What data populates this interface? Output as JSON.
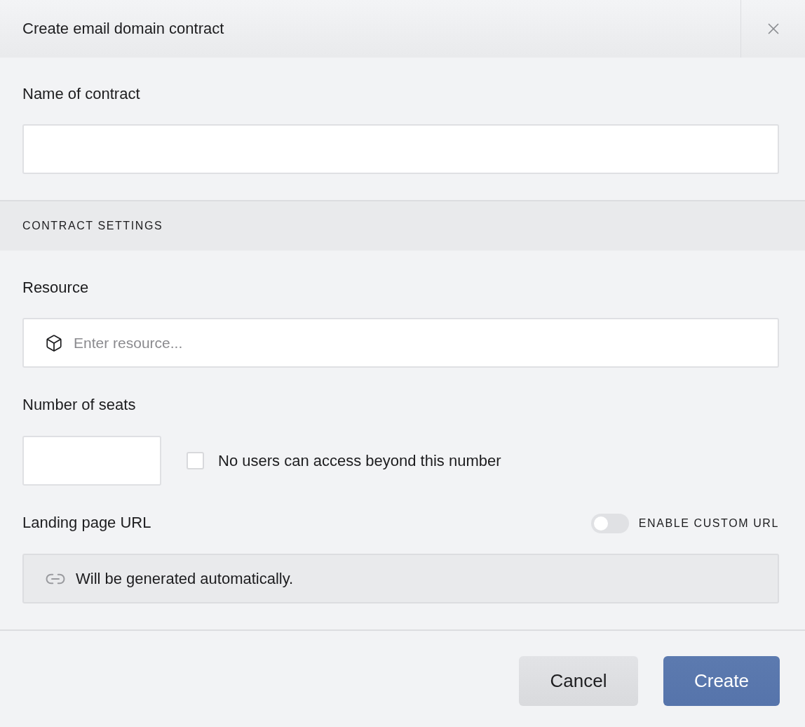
{
  "dialog": {
    "title": "Create email domain contract"
  },
  "name_field": {
    "label": "Name of contract"
  },
  "section": {
    "heading": "CONTRACT SETTINGS"
  },
  "resource_field": {
    "label": "Resource",
    "placeholder": "Enter resource..."
  },
  "seats_field": {
    "label": "Number of seats"
  },
  "seat_limit": {
    "label": "No users can access beyond this number",
    "checked": false
  },
  "landing_page": {
    "label": "Landing page URL",
    "custom_url_toggle": {
      "label": "ENABLE CUSTOM URL",
      "on": false
    },
    "url_field": {
      "value": "Will be generated automatically.",
      "disabled": true
    }
  },
  "buttons": [
    {
      "label": "Cancel",
      "kind": "secondary"
    },
    {
      "label": "Create",
      "kind": "primary"
    }
  ]
}
